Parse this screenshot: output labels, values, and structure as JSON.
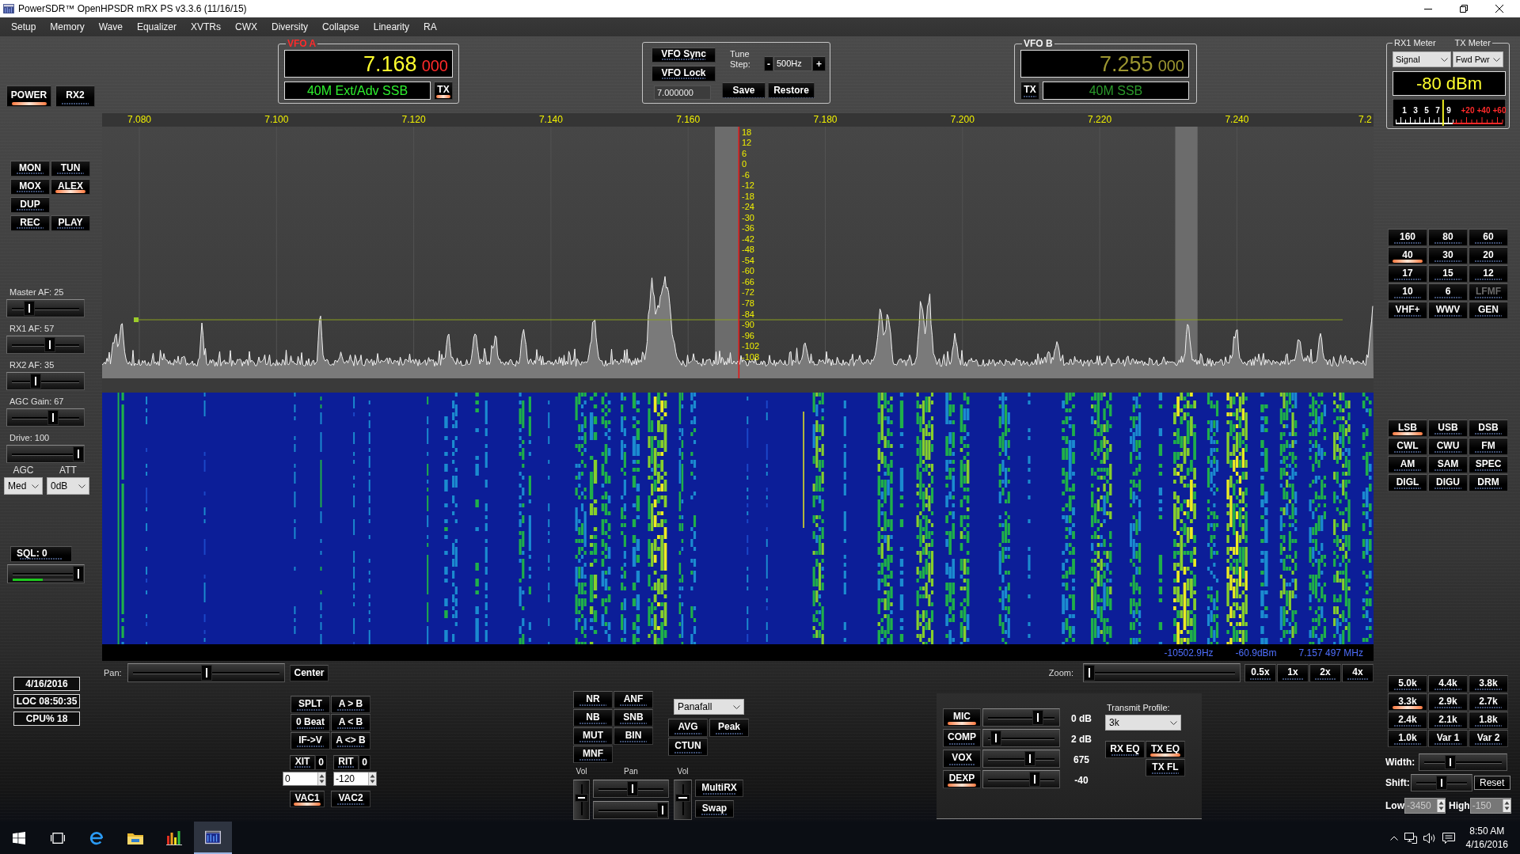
{
  "window": {
    "title": "PowerSDR™ OpenHPSDR mRX PS v3.3.6 (11/16/15)"
  },
  "menu": [
    "Setup",
    "Memory",
    "Wave",
    "Equalizer",
    "XVTRs",
    "CWX",
    "Diversity",
    "Collapse",
    "Linearity",
    "RA"
  ],
  "power_buttons": [
    {
      "label": "POWER",
      "on": true
    },
    {
      "label": "RX2",
      "on": false
    }
  ],
  "function_buttons": [
    [
      {
        "label": "MON",
        "on": false
      },
      {
        "label": "TUN",
        "on": false
      }
    ],
    [
      {
        "label": "MOX",
        "on": false
      },
      {
        "label": "ALEX",
        "on": true
      }
    ],
    [
      {
        "label": "DUP",
        "on": false
      }
    ],
    [
      {
        "label": "REC",
        "on": false
      },
      {
        "label": "PLAY",
        "on": false
      }
    ]
  ],
  "left_sliders": [
    {
      "label": "Master AF: 25",
      "level": 0.25
    },
    {
      "label": "RX1 AF: 57",
      "level": 0.57
    },
    {
      "label": "RX2 AF: 35",
      "level": 0.35
    },
    {
      "label": "AGC Gain: 67",
      "level": 0.62
    },
    {
      "label": "Drive: 100",
      "level": 1.0
    }
  ],
  "receiver_options": [
    {
      "label": "AGC",
      "value": "Med"
    },
    {
      "label": "ATT",
      "value": "0dB"
    }
  ],
  "squelch": {
    "button": {
      "label": "SQL: 0",
      "on": false
    },
    "slider": {
      "level": 1.0
    },
    "signal": {
      "level": 0.45
    }
  },
  "status": [
    "4/16/2016",
    "LOC 08:50:35",
    "CPU% 18"
  ],
  "vfo_a": {
    "title": "VFO A",
    "active": true,
    "mhz": "7.168",
    "hz": "000",
    "band": "40M Ext/Adv SSB",
    "tx": {
      "label": "TX",
      "on": true
    }
  },
  "tuning": {
    "buttons": [
      {
        "label": "VFO Sync",
        "on": false
      },
      {
        "label": "VFO Lock",
        "on": false
      }
    ],
    "frequency": "7.000000",
    "step": {
      "label": "Tune Step:",
      "minus": "-",
      "value": "500Hz",
      "plus": "+"
    },
    "memory_buttons": [
      "Save",
      "Restore"
    ]
  },
  "vfo_b": {
    "title": "VFO B",
    "active": false,
    "mhz": "7.255",
    "hz": "000",
    "band": "40M SSB",
    "tx": {
      "label": "TX",
      "on": false
    }
  },
  "meter": {
    "rx_label": "RX1 Meter",
    "tx_label": "TX Meter",
    "rx_mode": "Signal",
    "tx_mode": "Fwd Pwr",
    "reading": "-80 dBm",
    "scale": [
      {
        "text": "1",
        "color": "#ffffff"
      },
      {
        "text": "3",
        "color": "#ffffff"
      },
      {
        "text": "5",
        "color": "#ffffff"
      },
      {
        "text": "7",
        "color": "#ffffff"
      },
      {
        "text": "9",
        "color": "#ffffff"
      },
      {
        "text": "+20",
        "color": "#ff2a2a"
      },
      {
        "text": "+40",
        "color": "#ff2a2a"
      },
      {
        "text": "+60",
        "color": "#ff2a2a"
      }
    ],
    "needle": {
      "level": 0.44
    }
  },
  "panadapter": {
    "freq_labels": [
      "7.080",
      "7.100",
      "7.120",
      "7.140",
      "7.160",
      "7.180",
      "7.200",
      "7.220",
      "7.240",
      "7.2"
    ],
    "db_labels": [
      "18",
      "12",
      "6",
      "0",
      "-6",
      "-12",
      "-18",
      "-24",
      "-30",
      "-36",
      "-42",
      "-48",
      "-54",
      "-60",
      "-66",
      "-72",
      "-78",
      "-84",
      "-90",
      "-96",
      "-102",
      "-108"
    ]
  },
  "readout": [
    "-10502.9Hz",
    "-60.9dBm",
    "7.157 497 MHz"
  ],
  "pan": {
    "label": "Pan:",
    "level": 0.5,
    "button": "Center"
  },
  "zoom": {
    "label": "Zoom:",
    "level": 0.0,
    "buttons": [
      {
        "label": "0.5x",
        "on": false
      },
      {
        "label": "1x",
        "on": false
      },
      {
        "label": "2x",
        "on": false
      },
      {
        "label": "4x",
        "on": false
      }
    ]
  },
  "split_buttons": [
    [
      {
        "label": "SPLT",
        "on": false
      },
      {
        "label": "A > B",
        "on": false
      }
    ],
    [
      {
        "label": "0 Beat",
        "on": false
      },
      {
        "label": "A < B",
        "on": false
      }
    ],
    [
      {
        "label": "IF->V",
        "on": false
      },
      {
        "label": "A <> B",
        "on": false
      }
    ]
  ],
  "offsets": [
    {
      "label": "XIT",
      "on": false,
      "value": "0",
      "field": "0"
    },
    {
      "label": "RIT",
      "on": false,
      "value": "0",
      "field": "-120"
    }
  ],
  "vac_buttons": [
    {
      "label": "VAC1",
      "on": true
    },
    {
      "label": "VAC2",
      "on": false
    }
  ],
  "dsp_buttons": [
    [
      {
        "label": "NR",
        "on": false
      },
      {
        "label": "ANF",
        "on": false
      }
    ],
    [
      {
        "label": "NB",
        "on": false
      },
      {
        "label": "SNB",
        "on": false
      }
    ],
    [
      {
        "label": "MUT",
        "on": false
      },
      {
        "label": "BIN",
        "on": false
      }
    ],
    [
      {
        "label": "MNF",
        "on": false
      }
    ]
  ],
  "display_mode": "Panafall",
  "display_buttons": [
    [
      {
        "label": "AVG",
        "on": false
      },
      {
        "label": "Peak",
        "on": false
      }
    ],
    [
      {
        "label": "CTUN",
        "on": false
      }
    ]
  ],
  "multi_rx": {
    "labels": [
      "Vol",
      "Pan",
      "Vol"
    ],
    "volume_a": {
      "level": 0.56
    },
    "pan": {
      "level": 0.52
    },
    "balance": {
      "level": 1.0
    },
    "volume_b": {
      "level": 0.56
    },
    "buttons": [
      {
        "label": "MultiRX",
        "on": false
      },
      {
        "label": "Swap",
        "on": false
      }
    ]
  },
  "tx_controls": [
    {
      "label": "MIC",
      "on": true,
      "level": 0.75,
      "reading": "0 dB"
    },
    {
      "label": "COMP",
      "on": false,
      "level": 0.11,
      "reading": "2 dB"
    },
    {
      "label": "VOX",
      "on": false,
      "level": 0.64,
      "reading": "675"
    },
    {
      "label": "DEXP",
      "on": true,
      "level": 0.71,
      "reading": "-40"
    }
  ],
  "transmit_profile": {
    "label": "Transmit Profile:",
    "value": "3k"
  },
  "eq_buttons": [
    {
      "label": "RX EQ",
      "on": false
    },
    {
      "label": "TX EQ",
      "on": true
    },
    {
      "label": "TX FL",
      "on": false
    }
  ],
  "band_buttons": [
    {
      "label": "160",
      "selected": false,
      "disabled": false
    },
    {
      "label": "80",
      "selected": false,
      "disabled": false
    },
    {
      "label": "60",
      "selected": false,
      "disabled": false
    },
    {
      "label": "40",
      "selected": true,
      "disabled": false
    },
    {
      "label": "30",
      "selected": false,
      "disabled": false
    },
    {
      "label": "20",
      "selected": false,
      "disabled": false
    },
    {
      "label": "17",
      "selected": false,
      "disabled": false
    },
    {
      "label": "15",
      "selected": false,
      "disabled": false
    },
    {
      "label": "12",
      "selected": false,
      "disabled": false
    },
    {
      "label": "10",
      "selected": false,
      "disabled": false
    },
    {
      "label": "6",
      "selected": false,
      "disabled": false
    },
    {
      "label": "LFMF",
      "selected": false,
      "disabled": true
    },
    {
      "label": "VHF+",
      "selected": false,
      "disabled": false
    },
    {
      "label": "WWV",
      "selected": false,
      "disabled": false
    },
    {
      "label": "GEN",
      "selected": false,
      "disabled": false
    }
  ],
  "mode_buttons": [
    {
      "label": "LSB",
      "selected": true
    },
    {
      "label": "USB",
      "selected": false
    },
    {
      "label": "DSB",
      "selected": false
    },
    {
      "label": "CWL",
      "selected": false
    },
    {
      "label": "CWU",
      "selected": false
    },
    {
      "label": "FM",
      "selected": false
    },
    {
      "label": "AM",
      "selected": false
    },
    {
      "label": "SAM",
      "selected": false
    },
    {
      "label": "SPEC",
      "selected": false
    },
    {
      "label": "DIGL",
      "selected": false
    },
    {
      "label": "DIGU",
      "selected": false
    },
    {
      "label": "DRM",
      "selected": false
    }
  ],
  "filter_buttons": [
    {
      "label": "5.0k",
      "selected": false
    },
    {
      "label": "4.4k",
      "selected": false
    },
    {
      "label": "3.8k",
      "selected": false
    },
    {
      "label": "3.3k",
      "selected": true
    },
    {
      "label": "2.9k",
      "selected": false
    },
    {
      "label": "2.7k",
      "selected": false
    },
    {
      "label": "2.4k",
      "selected": false
    },
    {
      "label": "2.1k",
      "selected": false
    },
    {
      "label": "1.8k",
      "selected": false
    },
    {
      "label": "1.0k",
      "selected": false
    },
    {
      "label": "Var 1",
      "selected": false
    },
    {
      "label": "Var 2",
      "selected": false
    }
  ],
  "filter_width": {
    "label": "Width:",
    "level": 0.33
  },
  "filter_shift": {
    "label": "Shift:",
    "level": 0.51,
    "button": "Reset"
  },
  "filter_edges": [
    {
      "label": "Low",
      "value": "-3450",
      "disabled": true
    },
    {
      "label": "High",
      "value": "-150",
      "disabled": true
    }
  ],
  "taskbar": {
    "apps": [
      {
        "kind": "browser",
        "selected": false
      },
      {
        "kind": "folder",
        "selected": false
      },
      {
        "kind": "chart",
        "selected": false
      },
      {
        "kind": "radio",
        "selected": true
      }
    ],
    "time": "8:50 AM",
    "date": "4/16/2016"
  }
}
